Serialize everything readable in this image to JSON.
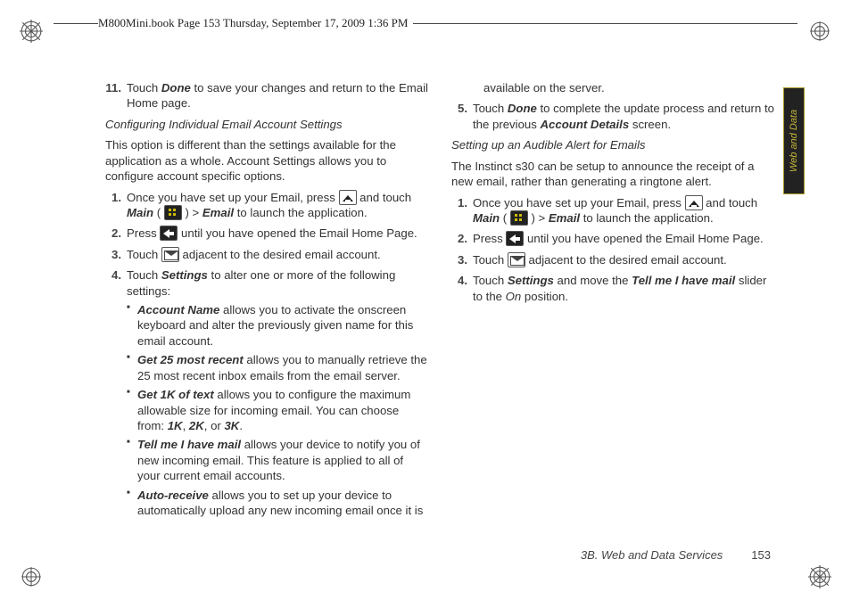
{
  "header": "M800Mini.book  Page 153  Thursday, September 17, 2009  1:36 PM",
  "side_tab": "Web and Data",
  "footer": {
    "section": "3B. Web and Data Services",
    "page": "153"
  },
  "col1": {
    "step11_num": "11.",
    "step11_a": "Touch ",
    "step11_done": "Done",
    "step11_b": " to save your changes and return to the Email Home page.",
    "h1": "Configuring Individual Email Account Settings",
    "intro": "This option is different than the settings available for the application as a whole. Account Settings allows you to configure account specific options.",
    "s1_num": "1.",
    "s1_a": "Once you have set up your Email, press ",
    "s1_b": " and touch ",
    "s1_main": "Main",
    "s1_c": " ( ",
    "s1_d": " ) > ",
    "s1_email": "Email",
    "s1_e": " to launch the application.",
    "s2_num": "2.",
    "s2_a": "Press ",
    "s2_b": " until you have opened the Email Home Page.",
    "s3_num": "3.",
    "s3_a": "Touch ",
    "s3_b": " adjacent to the desired email account.",
    "s4_num": "4.",
    "s4_a": "Touch ",
    "s4_set": "Settings",
    "s4_b": " to alter one or more of the following settings:",
    "sub1_t": "Account Name",
    "sub1_b": " allows you to activate the onscreen keyboard and alter the previously given name for this email account.",
    "sub2_t": "Get 25 most recent",
    "sub2_b": " allows you to manually retrieve the 25 most recent inbox emails from the email server."
  },
  "col2": {
    "sub3_t": "Get 1K of text",
    "sub3_a": " allows you to configure the maximum allowable size for incoming email. You can choose from: ",
    "sub3_1k": "1K",
    "sub3_c1": ", ",
    "sub3_2k": "2K",
    "sub3_c2": ", or ",
    "sub3_3k": "3K",
    "sub3_dot": ".",
    "sub4_t": "Tell me I have mail",
    "sub4_b": " allows your device to notify you of new incoming email. This feature is applied to all of your current email accounts.",
    "sub5_t": "Auto-receive",
    "sub5_b": " allows you to set up your device to automatically upload any new incoming email once it is available on the server.",
    "s5_num": "5.",
    "s5_a": "Touch ",
    "s5_done": "Done",
    "s5_b": " to complete the update process and return to the previous ",
    "s5_acct": "Account Details",
    "s5_c": " screen.",
    "h2": "Setting up an Audible Alert for Emails",
    "intro2": "The Instinct s30 can be setup to announce the receipt of a new email, rather than generating a ringtone alert.",
    "b1_num": "1.",
    "b1_a": "Once you have set up your Email, press ",
    "b1_b": " and touch ",
    "b1_main": "Main",
    "b1_c": " ( ",
    "b1_d": " ) > ",
    "b1_email": "Email",
    "b1_e": " to launch the application.",
    "b2_num": "2.",
    "b2_a": "Press ",
    "b2_b": " until you have opened the Email Home Page.",
    "b3_num": "3.",
    "b3_a": "Touch ",
    "b3_b": " adjacent to the desired email account.",
    "b4_num": "4.",
    "b4_a": "Touch ",
    "b4_set": "Settings",
    "b4_b": " and move the ",
    "b4_tell": "Tell me I have mail",
    "b4_c": " slider to the ",
    "b4_on": "On",
    "b4_d": " position."
  }
}
